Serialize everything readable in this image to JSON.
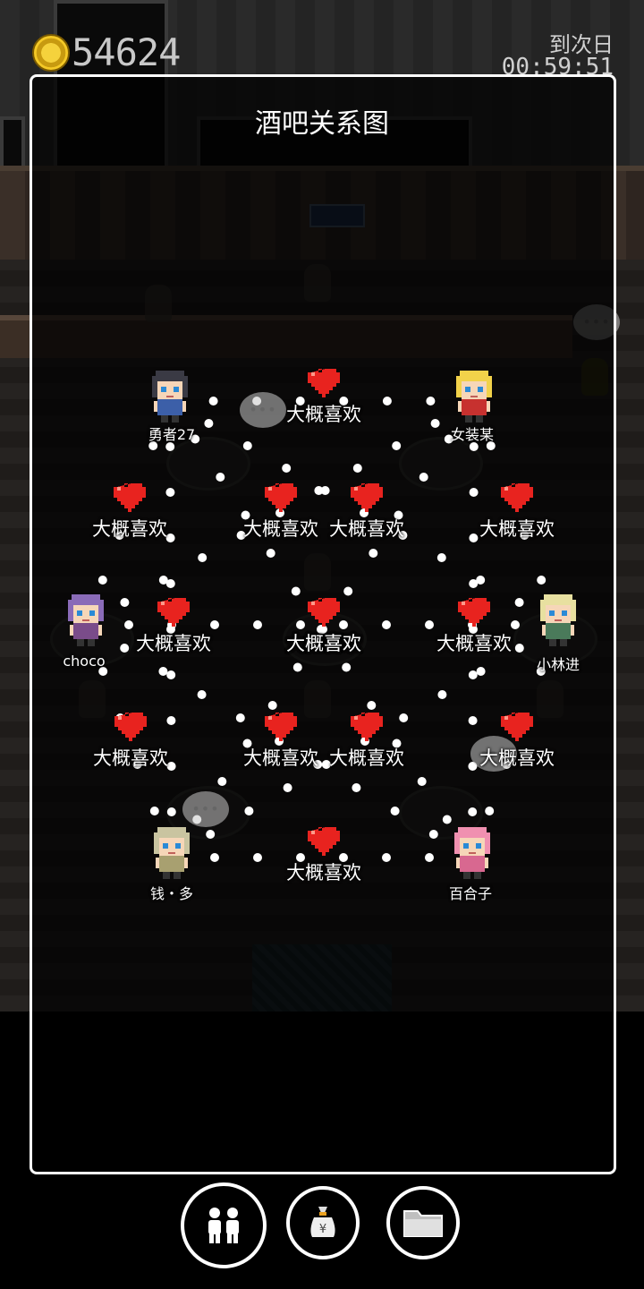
{
  "hud": {
    "coins": "54624",
    "timer_label": "到次日",
    "timer_value": "00:59:51"
  },
  "panel": {
    "title": "酒吧关系图"
  },
  "characters": [
    {
      "id": "c1",
      "name": "勇者27",
      "hair": "#3a3a44",
      "body": "#3c5fa8"
    },
    {
      "id": "c2",
      "name": "女装某",
      "hair": "#f2d24a",
      "body": "#c7312f"
    },
    {
      "id": "c3",
      "name": "choco",
      "hair": "#8a6bb8",
      "body": "#7a4c8a"
    },
    {
      "id": "c4",
      "name": "小林进",
      "hair": "#e8e0a0",
      "body": "#4a7a5a"
    },
    {
      "id": "c5",
      "name": "钱・多",
      "hair": "#c9c4a0",
      "body": "#a8a070"
    },
    {
      "id": "c6",
      "name": "百合子",
      "hair": "#f090b0",
      "body": "#d86890"
    }
  ],
  "relations": [
    {
      "label": "大概喜欢"
    },
    {
      "label": "大概喜欢"
    },
    {
      "label": "大概喜欢"
    },
    {
      "label": "大概喜欢"
    },
    {
      "label": "大概喜欢"
    },
    {
      "label": "大概喜欢"
    },
    {
      "label": "大概喜欢"
    },
    {
      "label": "大概喜欢"
    },
    {
      "label": "大概喜欢"
    },
    {
      "label": "大概喜欢"
    },
    {
      "label": "大概喜欢"
    },
    {
      "label": "大概喜欢"
    },
    {
      "label": "大概喜欢"
    },
    {
      "label": "大概喜欢"
    },
    {
      "label": "大概喜欢"
    }
  ],
  "bottom_bar": {
    "buttons": [
      {
        "icon": "people-icon",
        "active": true
      },
      {
        "icon": "money-bag-icon",
        "active": false
      },
      {
        "icon": "folder-icon",
        "active": false
      }
    ]
  },
  "colors": {
    "heart": "#e8231f",
    "panel_border": "#ffffff",
    "dots": "#ffffff"
  }
}
